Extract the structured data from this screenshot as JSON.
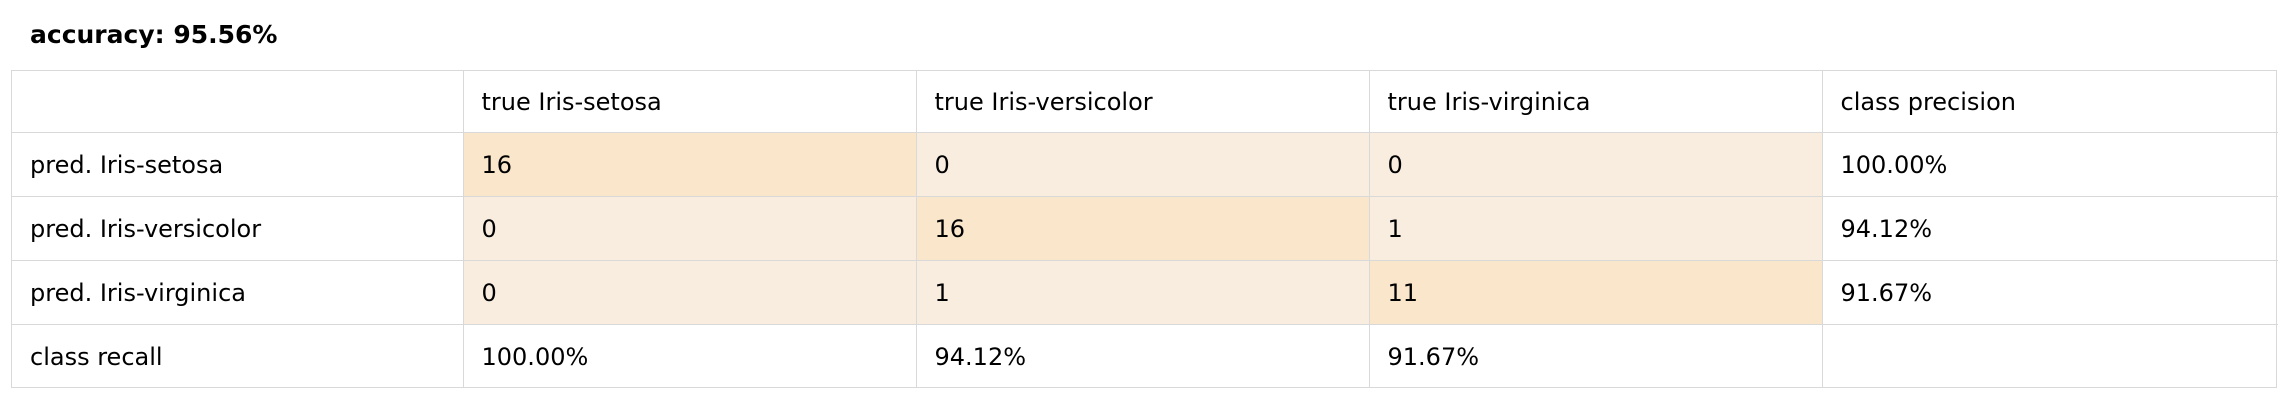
{
  "accuracy_label": "accuracy: 95.56%",
  "columns": [
    "",
    "true Iris-setosa",
    "true Iris-versicolor",
    "true Iris-virginica",
    "class precision"
  ],
  "rows": [
    {
      "label": "pred. Iris-setosa",
      "cells": [
        "16",
        "0",
        "0"
      ],
      "precision": "100.00%"
    },
    {
      "label": "pred. Iris-versicolor",
      "cells": [
        "0",
        "16",
        "1"
      ],
      "precision": "94.12%"
    },
    {
      "label": "pred. Iris-virginica",
      "cells": [
        "0",
        "1",
        "11"
      ],
      "precision": "91.67%"
    }
  ],
  "recall_row": {
    "label": "class recall",
    "cells": [
      "100.00%",
      "94.12%",
      "91.67%"
    ],
    "blank": ""
  },
  "colors": {
    "diagonal": "#f9e6cb",
    "off_diagonal": "#f9ede0",
    "border": "#d9d9d9"
  }
}
